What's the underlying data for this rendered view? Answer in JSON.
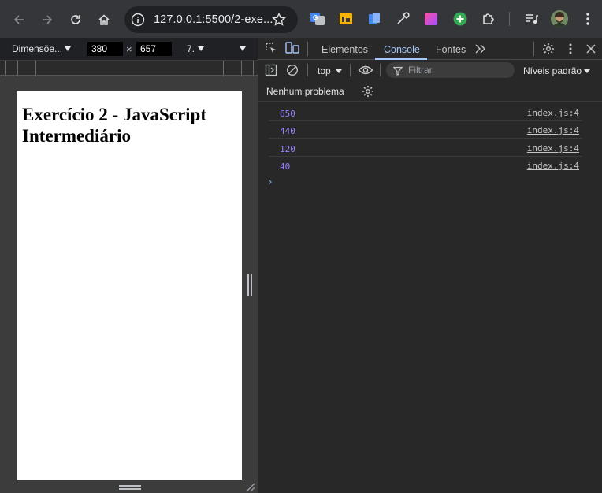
{
  "browser": {
    "url": "127.0.0.1:5500/2-exe...",
    "icons": [
      "back-arrow-icon",
      "forward-arrow-icon",
      "reload-icon",
      "home-icon",
      "site-info-icon",
      "bookmark-star-icon",
      "translate-extension-icon",
      "ext-yellow-icon",
      "ext-blue-icon",
      "eyedropper-icon",
      "ext-gradient-icon",
      "ext-green-plus-icon",
      "extensions-puzzle-icon",
      "media-queue-icon",
      "profile-avatar",
      "kebab-menu-icon"
    ]
  },
  "device_toolbar": {
    "dimensions_label": "Dimensõe...",
    "width": "380",
    "height": "657",
    "times": "×",
    "zoom": "7."
  },
  "page": {
    "heading": "Exercício 2 - JavaScript Intermediário"
  },
  "devtools": {
    "tabs": [
      {
        "label": "Elementos"
      },
      {
        "label": "Console"
      },
      {
        "label": "Fontes"
      }
    ],
    "context": "top",
    "filter_placeholder": "Filtrar",
    "levels_label": "Níveis padrão",
    "issues_label": "Nenhum problema",
    "logs": [
      {
        "value": "650",
        "source": "index.js:4"
      },
      {
        "value": "440",
        "source": "index.js:4"
      },
      {
        "value": "120",
        "source": "index.js:4"
      },
      {
        "value": "40",
        "source": "index.js:4"
      }
    ],
    "prompt": "›"
  },
  "colors": {
    "toolbar": "#35363a",
    "devtools_bg": "#282828",
    "active_tab": "#a8c7fa",
    "log_value": "#9980ff"
  }
}
